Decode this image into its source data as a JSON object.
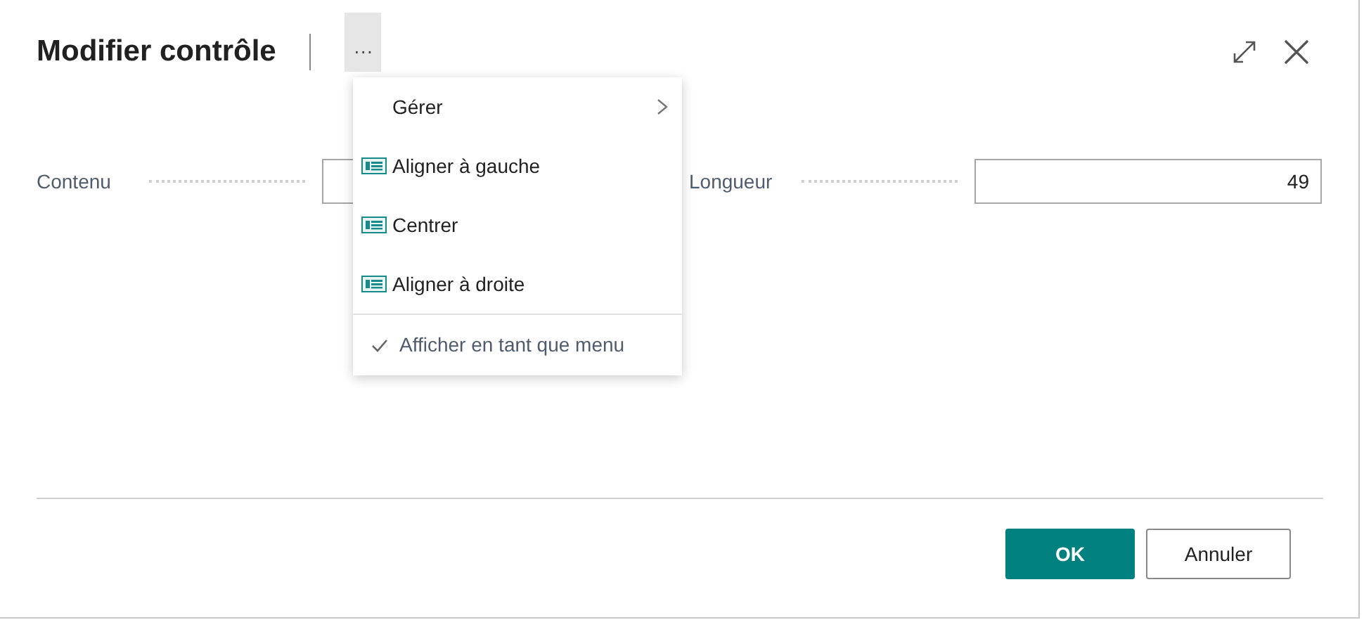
{
  "dialog": {
    "title": "Modifier contrôle",
    "more_button": "···"
  },
  "menu": {
    "items": [
      {
        "kind": "submenu",
        "label": "Gérer"
      },
      {
        "kind": "action",
        "label": "Aligner à gauche"
      },
      {
        "kind": "action",
        "label": "Centrer"
      },
      {
        "kind": "action",
        "label": "Aligner à droite"
      },
      {
        "kind": "toggle",
        "label": "Afficher en tant que menu",
        "checked": true
      }
    ]
  },
  "fields": [
    {
      "label": "Contenu"
    },
    {
      "label": "Longueur",
      "value": "49"
    }
  ],
  "buttons": [
    {
      "label": "OK",
      "primary": true
    },
    {
      "label": "Annuler",
      "primary": false
    }
  ]
}
